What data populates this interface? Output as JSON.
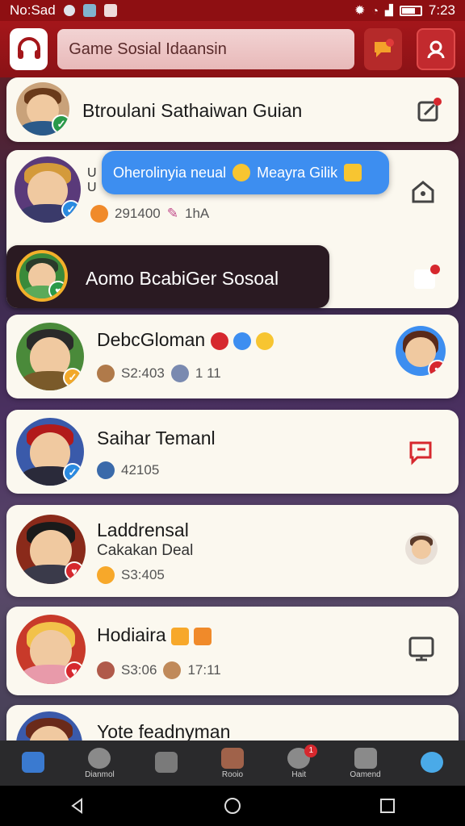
{
  "status_bar": {
    "carrier": "No:Sad",
    "time": "7:23"
  },
  "header": {
    "search_text": "Game Sosial Idaansin"
  },
  "toast": {
    "text": "Oherolinyia neual",
    "text2": "Meayra Gilik"
  },
  "cards": [
    {
      "title": "Btroulani Sathaiwan Guian"
    },
    {
      "title": "U",
      "subtitle": "U",
      "stat": "291400",
      "stat2": "1hA"
    },
    {
      "title": "Aomo BcabiGer Sosoal"
    },
    {
      "title": "DebcGloman",
      "stat": "S2:403",
      "stat2": "1 11"
    },
    {
      "title": "Saihar Temanl",
      "stat": "42105"
    },
    {
      "title": "Laddrensal",
      "subtitle": "Cakakan Deal",
      "stat": "S3:405"
    },
    {
      "title": "Hodiaira",
      "stat": "S3:06",
      "stat2": "17:11"
    },
    {
      "title": "Yote feadnyman"
    }
  ],
  "bottom_nav": [
    {
      "label": "",
      "icon": "home-icon"
    },
    {
      "label": "Dianmol",
      "icon": "diamond-icon"
    },
    {
      "label": "",
      "icon": "chat-icon"
    },
    {
      "label": "Rooio",
      "icon": "gift-icon"
    },
    {
      "label": "Hait",
      "icon": "notification-icon",
      "badge": "1"
    },
    {
      "label": "Oamend",
      "icon": "store-icon"
    },
    {
      "label": "",
      "icon": "profile-icon"
    }
  ],
  "colors": {
    "appbar": "#a4161a",
    "accent": "#3d8ef0",
    "card": "#fbf8ef"
  }
}
